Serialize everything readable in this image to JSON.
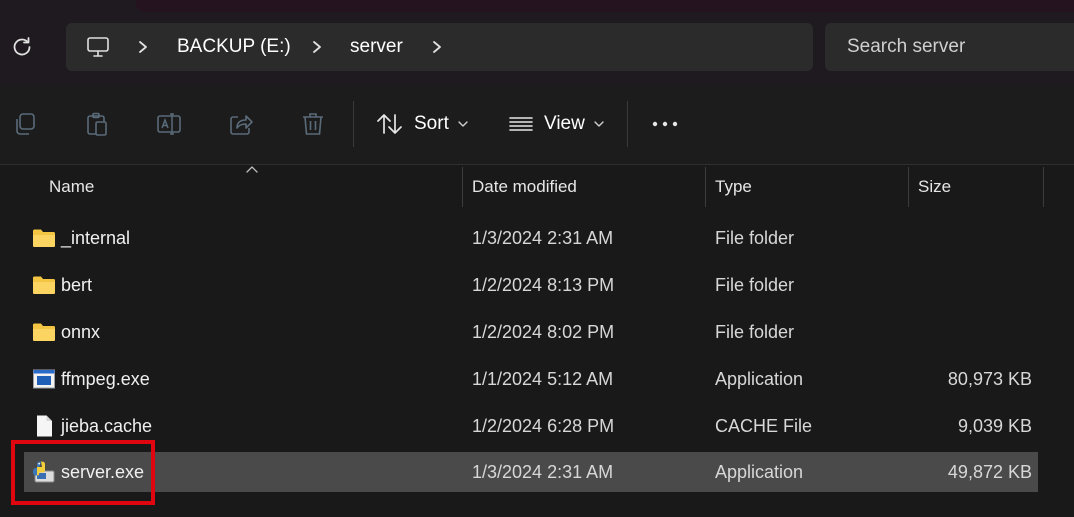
{
  "nav": {
    "refresh_icon": "refresh-icon",
    "breadcrumb": [
      "BACKUP (E:)",
      "server"
    ],
    "pc_icon": "this-pc-icon",
    "search_placeholder": "Search server"
  },
  "toolbar": {
    "icons": [
      "copy-icon",
      "paste-icon",
      "rename-icon",
      "share-icon",
      "delete-icon"
    ],
    "sort_label": "Sort",
    "view_label": "View",
    "more_icon": "more-icon"
  },
  "columns": {
    "name": "Name",
    "date": "Date modified",
    "type": "Type",
    "size": "Size"
  },
  "files": [
    {
      "name": "_internal",
      "date": "1/3/2024 2:31 AM",
      "type": "File folder",
      "size": "",
      "icon": "folder-icon"
    },
    {
      "name": "bert",
      "date": "1/2/2024 8:13 PM",
      "type": "File folder",
      "size": "",
      "icon": "folder-icon"
    },
    {
      "name": "onnx",
      "date": "1/2/2024 8:02 PM",
      "type": "File folder",
      "size": "",
      "icon": "folder-icon"
    },
    {
      "name": "ffmpeg.exe",
      "date": "1/1/2024 5:12 AM",
      "type": "Application",
      "size": "80,973 KB",
      "icon": "app-icon"
    },
    {
      "name": "jieba.cache",
      "date": "1/2/2024 6:28 PM",
      "type": "CACHE File",
      "size": "9,039 KB",
      "icon": "file-icon"
    },
    {
      "name": "server.exe",
      "date": "1/3/2024 2:31 AM",
      "type": "Application",
      "size": "49,872 KB",
      "icon": "python-exe-icon"
    }
  ],
  "selected_file": "server.exe",
  "colors": {
    "background": "#191919",
    "selected_row": "#4a4a4a",
    "highlight_box": "#e0060f",
    "folder": "#f4c542"
  }
}
